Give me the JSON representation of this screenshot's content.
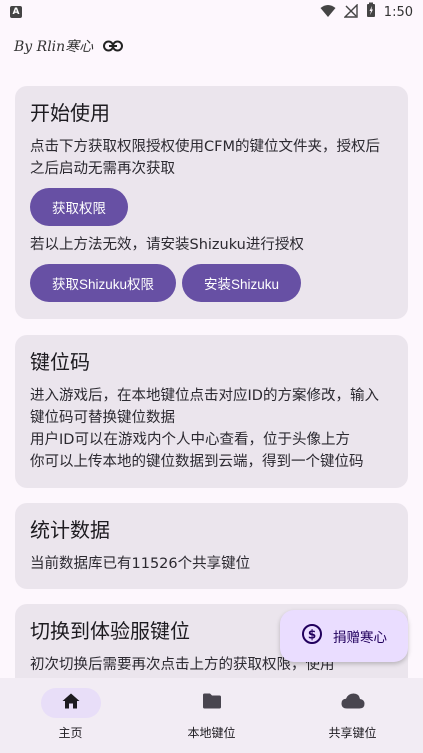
{
  "status_bar": {
    "notification_icon": "a-icon",
    "time": "1:50"
  },
  "header": {
    "brand": "By Rlin寒心",
    "link_icon": "link-icon"
  },
  "cards": {
    "start": {
      "title": "开始使用",
      "text": "点击下方获取权限授权使用CFM的键位文件夹，授权后之后启动无需再次获取",
      "get_permission_button": "获取权限",
      "shizuku_hint": "若以上方法无效，请安装Shizuku进行授权",
      "shizuku_permission_button": "获取Shizuku权限",
      "install_shizuku_button": "安装Shizuku"
    },
    "keycode": {
      "title": "键位码",
      "text1": "进入游戏后，在本地键位点击对应ID的方案修改，输入键位码可替换键位数据",
      "text2": "用户ID可以在游戏内个人中心查看，位于头像上方",
      "text3": "你可以上传本地的键位数据到云端，得到一个键位码"
    },
    "stats": {
      "title": "统计数据",
      "text": "当前数据库已有11526个共享键位"
    },
    "switch": {
      "title": "切换到体验服键位",
      "text": "初次切换后需要再次点击上方的获取权限，使用"
    }
  },
  "fab": {
    "label": "捐赠寒心",
    "icon": "dollar-icon"
  },
  "bottom_nav": {
    "items": [
      {
        "label": "主页",
        "icon": "home-icon",
        "active": true
      },
      {
        "label": "本地键位",
        "icon": "folder-icon",
        "active": false
      },
      {
        "label": "共享键位",
        "icon": "cloud-icon",
        "active": false
      }
    ]
  },
  "colors": {
    "accent": "#6750a4",
    "card_bg": "#ebe5ed",
    "fab_bg": "#eaddff",
    "nav_bg": "#f2ecf4"
  }
}
